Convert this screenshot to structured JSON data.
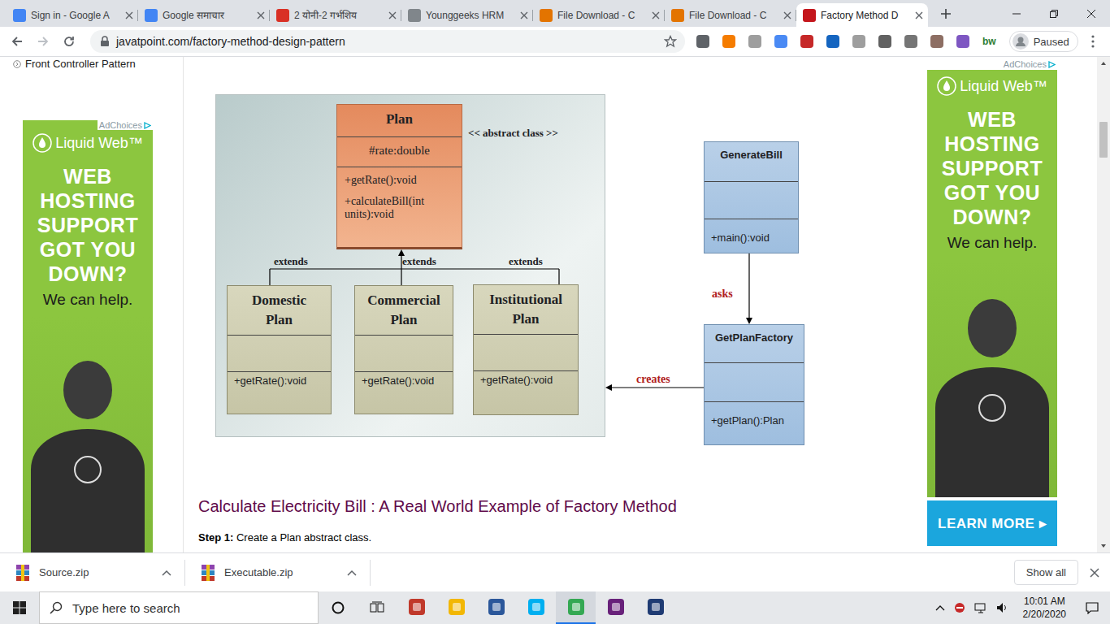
{
  "browser": {
    "tabs": [
      {
        "label": "Sign in - Google A",
        "selected": false
      },
      {
        "label": "Google समाचार",
        "selected": false
      },
      {
        "label": "2 योनी-2 गर्भशिय",
        "selected": false
      },
      {
        "label": "Younggeeks HRM",
        "selected": false
      },
      {
        "label": "File Download - C",
        "selected": false
      },
      {
        "label": "File Download - C",
        "selected": false
      },
      {
        "label": "Factory Method D",
        "selected": true
      }
    ],
    "address": "javatpoint.com/factory-method-design-pattern",
    "extension_text": "bw",
    "profile": "Paused"
  },
  "sidebar": {
    "items": [
      {
        "label": "Front Controller Pattern"
      }
    ]
  },
  "ads": [
    {
      "side": "left",
      "ad_choices": "AdChoices",
      "brand": "Liquid Web™",
      "headline": "WEB HOSTING SUPPORT GOT YOU DOWN?",
      "tagline": "We can help."
    },
    {
      "side": "right",
      "ad_choices": "AdChoices",
      "brand": "Liquid Web™",
      "headline": "WEB HOSTING SUPPORT GOT YOU DOWN?",
      "tagline": "We can help.",
      "button": "LEARN MORE ▸"
    }
  ],
  "diagram": {
    "abstract": {
      "name": "Plan",
      "stereotype": "<< abstract class >>",
      "attributes": [
        "#rate:double"
      ],
      "methods": [
        "+getRate():void",
        "+calculateBill(int units):void"
      ]
    },
    "subclasses": [
      {
        "name": "Domestic Plan",
        "relation": "extends",
        "methods": [
          "+getRate():void"
        ]
      },
      {
        "name": "Commercial Plan",
        "relation": "extends",
        "methods": [
          "+getRate():void"
        ]
      },
      {
        "name": "Institutional Plan",
        "relation": "extends",
        "methods": [
          "+getRate():void"
        ]
      }
    ],
    "client": {
      "name": "GenerateBill",
      "methods": [
        "+main():void"
      ]
    },
    "factory": {
      "name": "GetPlanFactory",
      "methods": [
        "+getPlan():Plan"
      ]
    },
    "links": {
      "asks": "asks",
      "creates": "creates"
    }
  },
  "article": {
    "heading": "Calculate Electricity Bill : A Real World Example of Factory Method",
    "steps": [
      {
        "label": "Step 1:",
        "text": "Create a Plan abstract class."
      }
    ]
  },
  "downloads": {
    "items": [
      "Source.zip",
      "Executable.zip"
    ],
    "show_all": "Show all"
  },
  "taskbar": {
    "search": "Type here to search",
    "time": "10:01 AM",
    "date": "2/20/2020"
  }
}
